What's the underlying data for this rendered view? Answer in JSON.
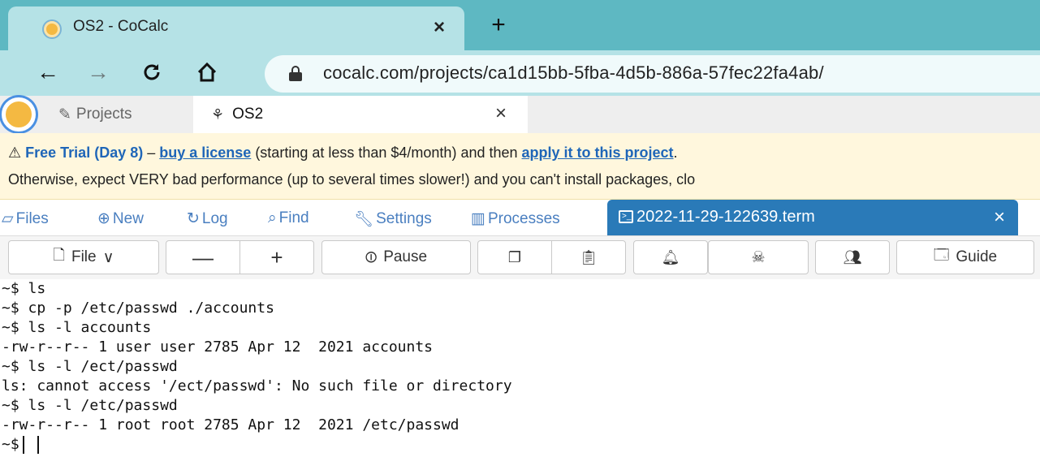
{
  "browser": {
    "tab_title": "OS2 - CoCalc",
    "tab_close": "×",
    "new_tab": "+",
    "url": "cocalc.com/projects/ca1d15bb-5fba-4d5b-886a-57fec22fa4ab/"
  },
  "cocalc": {
    "projects_label": "Projects",
    "project_tab_label": "OS2",
    "project_tab_close": "×"
  },
  "banner": {
    "warn_glyph": "⚠",
    "trial": "Free Trial (Day 8)",
    "dash": " – ",
    "buy_link": "buy a license",
    "mid_text": " (starting at less than $4/month) and then ",
    "apply_link": "apply it to this project",
    "end_text": ".",
    "line2": "Otherwise, expect VERY bad performance (up to several times slower!) and you can't install packages, clo"
  },
  "project_nav": {
    "files": "Files",
    "new": "New",
    "log": "Log",
    "find": "Find",
    "settings": "Settings",
    "processes": "Processes",
    "file_tab_label": "2022-11-29-122639.term",
    "file_tab_close": "×"
  },
  "toolbar": {
    "file": "File",
    "minus": "—",
    "plus": "+",
    "pause": "Pause",
    "guide": "Guide"
  },
  "terminal": {
    "lines": [
      "~$ ls",
      "~$ cp -p /etc/passwd ./accounts",
      "~$ ls -l accounts",
      "-rw-r--r-- 1 user user 2785 Apr 12  2021 accounts",
      "~$ ls -l /ect/passwd",
      "ls: cannot access '/ect/passwd': No such file or directory",
      "~$ ls -l /etc/passwd",
      "-rw-r--r-- 1 root root 2785 Apr 12  2021 /etc/passwd",
      "~$"
    ]
  },
  "colors": {
    "tabstrip": "#5eb8c2",
    "address_bar": "#b5e2e6",
    "link_blue": "#1f66b8",
    "file_tab": "#2a7ab8",
    "banner_bg": "#fff7dd"
  }
}
